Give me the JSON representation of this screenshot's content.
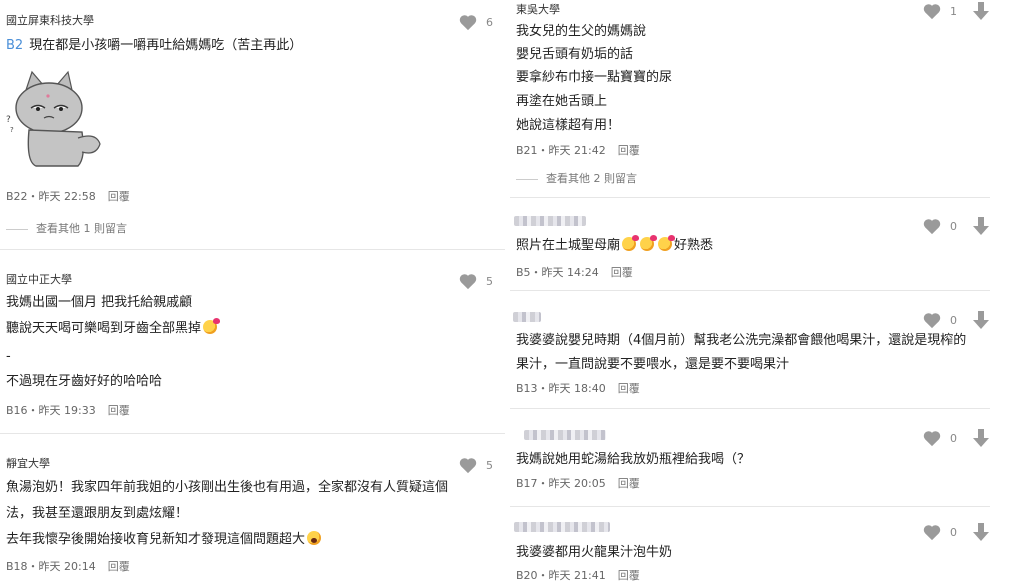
{
  "left": [
    {
      "school": "國立屏東科技大學",
      "likes": "6",
      "floor": "B2",
      "lines": [
        "現在都是小孩嚼一嚼再吐給媽媽吃（苦主再此）"
      ],
      "sticker": "gray-cat-sticker",
      "meta": "B22・昨天 22:58",
      "reply": "回覆",
      "more": "查看其他 1 則留言"
    },
    {
      "school": "國立中正大學",
      "likes": "5",
      "lines": [
        "我媽出國一個月 把我托給親戚顧",
        "聽說天天喝可樂喝到牙齒全部黑掉",
        "-",
        "不過現在牙齒好好的哈哈哈"
      ],
      "meta": "B16・昨天 19:33",
      "reply": "回覆"
    },
    {
      "school": "靜宜大學",
      "likes": "5",
      "lines": [
        "魚湯泡奶！我家四年前我姐的小孩剛出生後也有用過，全家都沒有人質疑這個",
        "法，我甚至還跟朋友到處炫耀！",
        "去年我懷孕後開始接收育兒新知才發現這個問題超大"
      ],
      "meta": "B18・昨天 20:14",
      "reply": "回覆"
    }
  ],
  "right": [
    {
      "school": "東吳大學",
      "likes": "1",
      "lines": [
        "我女兒的生父的媽媽說",
        "嬰兒舌頭有奶垢的話",
        "要拿紗布巾接一點寶寶的尿",
        "再塗在她舌頭上",
        "她說這樣超有用！"
      ],
      "meta": "B21・昨天 21:42",
      "reply": "回覆",
      "more": "查看其他 2 則留言"
    },
    {
      "likes": "0",
      "lines": [
        "照片在土城聖母廟",
        "好熟悉"
      ],
      "meta": "B5・昨天 14:24",
      "reply": "回覆"
    },
    {
      "likes": "0",
      "lines": [
        "我婆婆說嬰兒時期（4個月前）幫我老公洗完澡都會餵他喝果汁，還說是現榨的",
        "果汁，一直問說要不要喂水，還是要不要喝果汁"
      ],
      "meta": "B13・昨天 18:40",
      "reply": "回覆"
    },
    {
      "likes": "0",
      "lines": [
        "我媽說她用蛇湯給我放奶瓶裡給我喝（？"
      ],
      "meta": "B17・昨天 20:05",
      "reply": "回覆"
    },
    {
      "likes": "0",
      "lines": [
        "我婆婆都用火龍果汁泡牛奶"
      ],
      "meta": "B20・昨天 21:41",
      "reply": "回覆"
    }
  ],
  "icons": {
    "like": "heart-icon",
    "downvote": "downvote-arrow-icon"
  },
  "colors": {
    "icon_gray": "#9a9a9a",
    "floor_blue": "#4a8fd8",
    "divider": "#e6e6e6"
  }
}
